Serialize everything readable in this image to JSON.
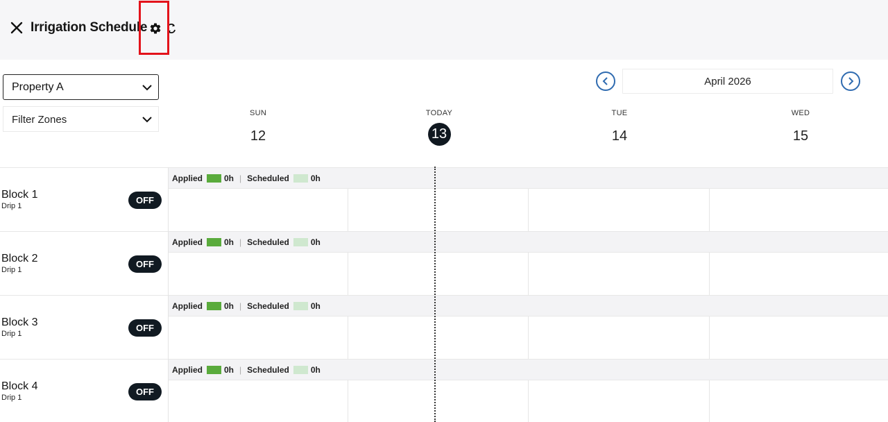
{
  "header": {
    "title": "Irrigation Schedule"
  },
  "filters": {
    "property": "Property A",
    "zones": "Filter Zones"
  },
  "calendar": {
    "month": "April 2026",
    "days": [
      {
        "dow": "SUN",
        "num": "12"
      },
      {
        "dow": "TODAY",
        "num": "13"
      },
      {
        "dow": "TUE",
        "num": "14"
      },
      {
        "dow": "WED",
        "num": "15"
      }
    ]
  },
  "colors": {
    "applied": "#5aab3c",
    "scheduled": "#cfe8cf",
    "highlight": "#e3131b",
    "nav_accent": "#2f6bb0",
    "toggle_bg": "#111a22"
  },
  "blocks": [
    {
      "name": "Block 1",
      "sub": "Drip 1",
      "toggle": "OFF",
      "applied_label": "Applied",
      "applied_value": "0h",
      "scheduled_label": "Scheduled",
      "scheduled_value": "0h"
    },
    {
      "name": "Block 2",
      "sub": "Drip 1",
      "toggle": "OFF",
      "applied_label": "Applied",
      "applied_value": "0h",
      "scheduled_label": "Scheduled",
      "scheduled_value": "0h"
    },
    {
      "name": "Block 3",
      "sub": "Drip 1",
      "toggle": "OFF",
      "applied_label": "Applied",
      "applied_value": "0h",
      "scheduled_label": "Scheduled",
      "scheduled_value": "0h"
    },
    {
      "name": "Block 4",
      "sub": "Drip 1",
      "toggle": "OFF",
      "applied_label": "Applied",
      "applied_value": "0h",
      "scheduled_label": "Scheduled",
      "scheduled_value": "0h"
    }
  ]
}
